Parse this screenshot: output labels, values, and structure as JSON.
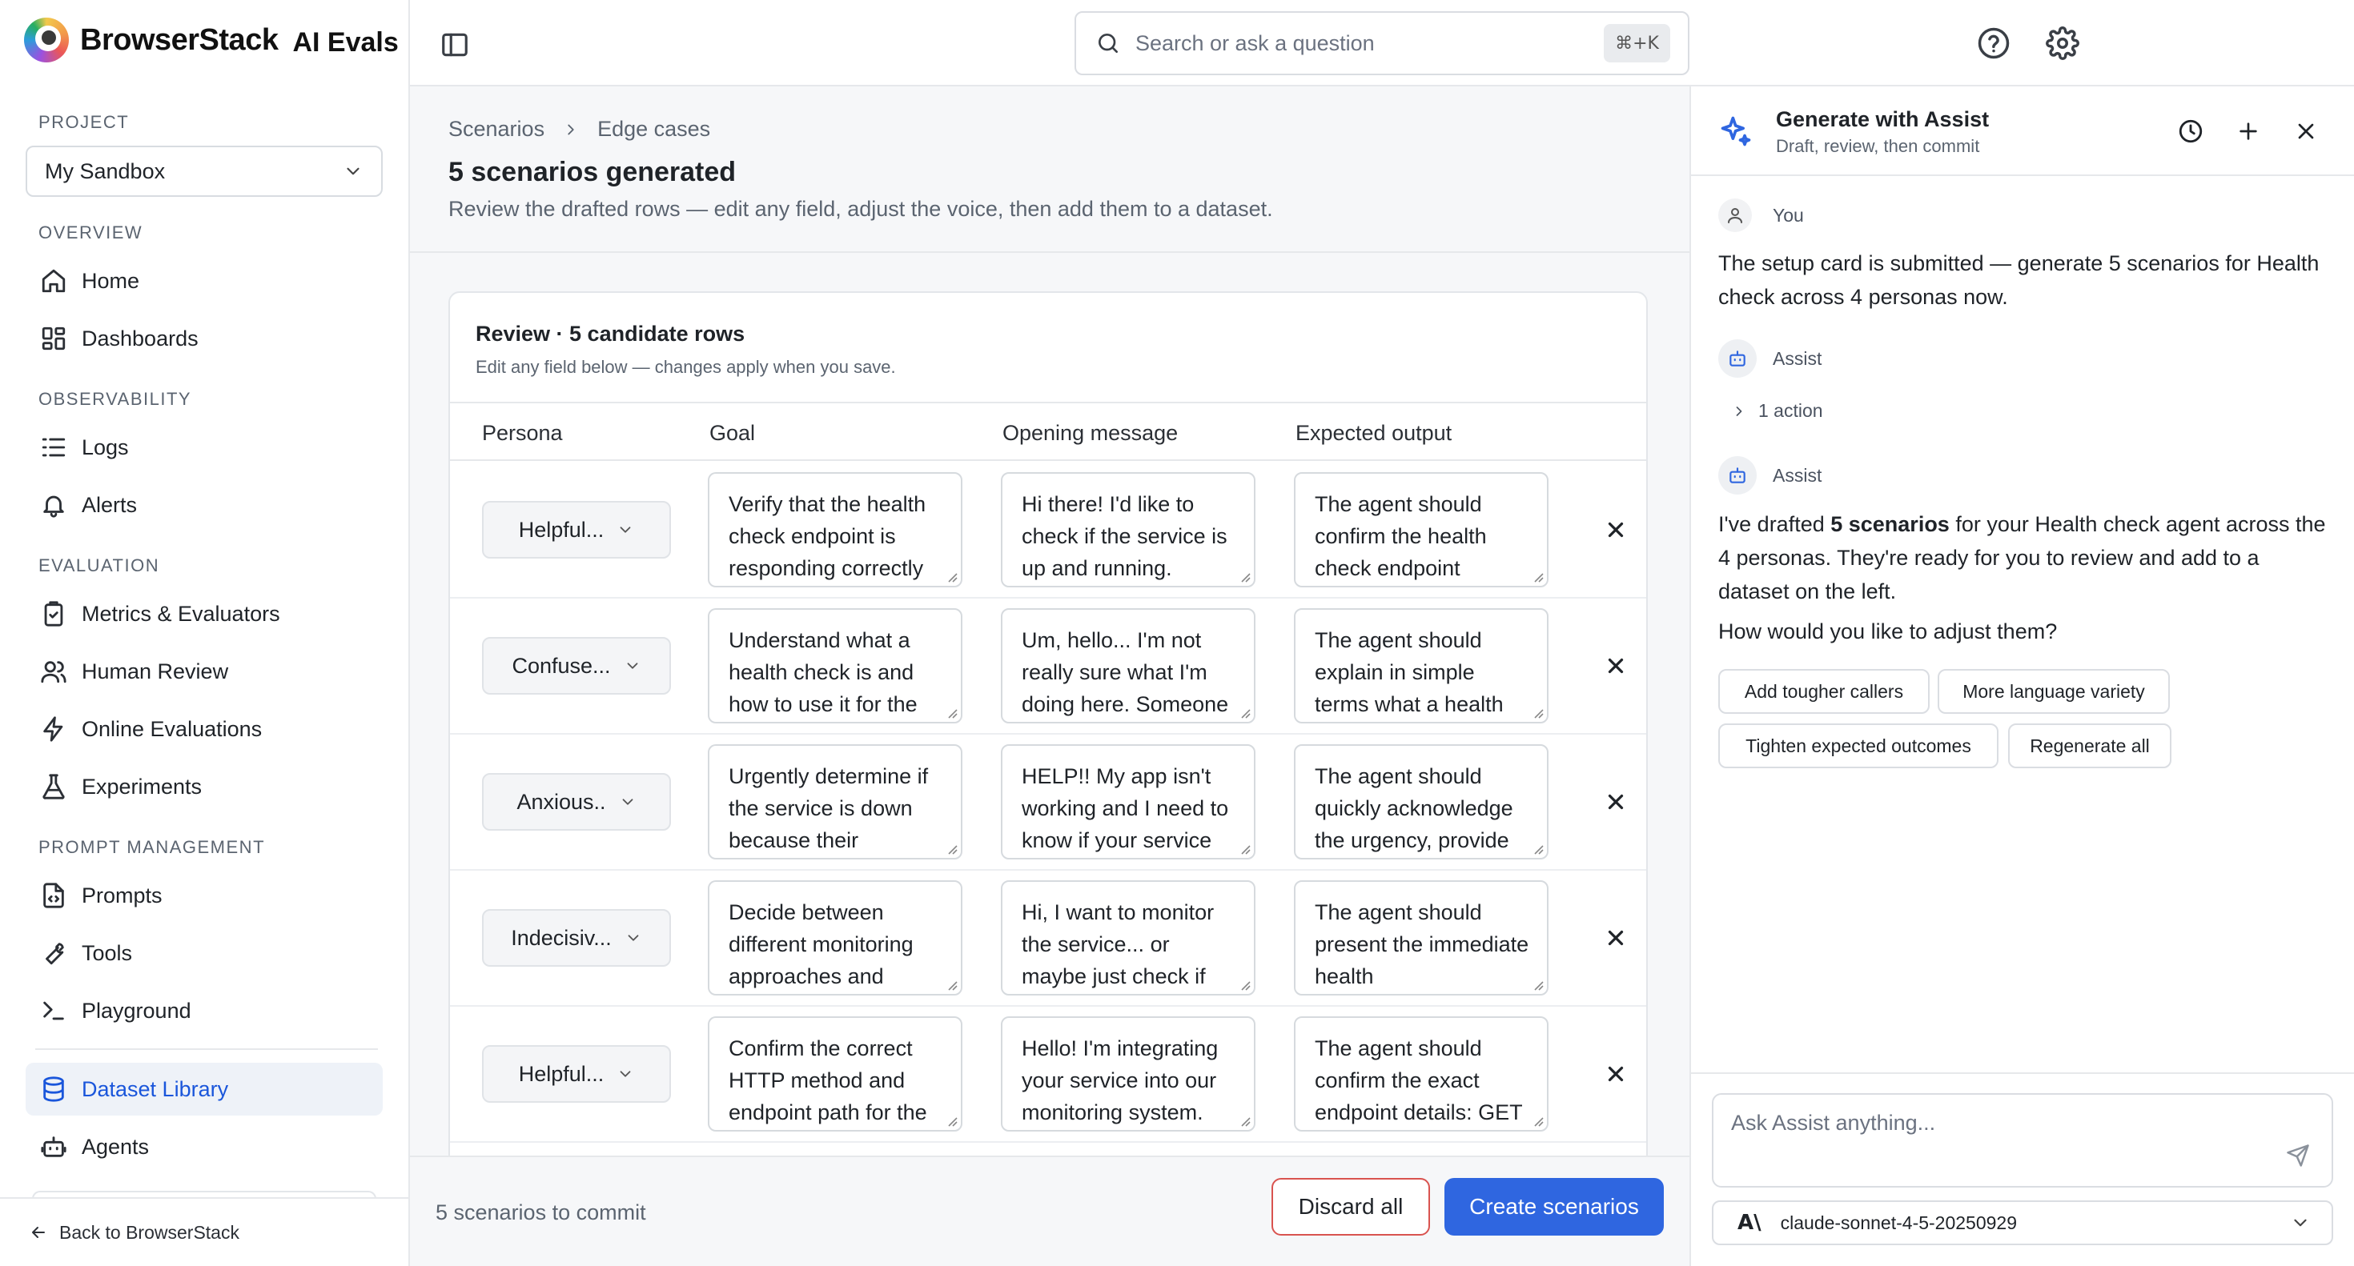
{
  "brand": {
    "name": "BrowserStack",
    "product": "AI Evals"
  },
  "sidebar": {
    "project_label": "PROJECT",
    "project_value": "My Sandbox",
    "sections": {
      "overview": "OVERVIEW",
      "observability": "OBSERVABILITY",
      "evaluation": "EVALUATION",
      "prompt_management": "PROMPT MANAGEMENT"
    },
    "items": {
      "home": "Home",
      "dashboards": "Dashboards",
      "logs": "Logs",
      "alerts": "Alerts",
      "metrics": "Metrics & Evaluators",
      "human_review": "Human Review",
      "online_evaluations": "Online Evaluations",
      "experiments": "Experiments",
      "prompts": "Prompts",
      "tools": "Tools",
      "playground": "Playground",
      "dataset_library": "Dataset Library",
      "agents": "Agents"
    },
    "active_item": "Dataset Library",
    "back_link": "Back to BrowserStack"
  },
  "topbar": {
    "search_placeholder": "Search or ask a question",
    "search_shortcut": "⌘+K",
    "icons": [
      "sidebar-toggle-icon",
      "help-icon",
      "settings-icon"
    ]
  },
  "main": {
    "breadcrumb": [
      "Scenarios",
      "Edge cases"
    ],
    "title": "5 scenarios generated",
    "subtitle": "Review the drafted rows — edit any field, adjust the voice, then add them to a dataset.",
    "review_title": "Review · 5 candidate rows",
    "review_subtitle": "Edit any field below — changes apply when you save.",
    "columns": [
      "Persona",
      "Goal",
      "Opening message",
      "Expected output"
    ],
    "rows": [
      {
        "persona": "Helpful...",
        "goal": "Verify that the health check endpoint is responding correctly",
        "opening": "Hi there! I'd like to check if the service is up and running.",
        "expected": "The agent should confirm the health check endpoint"
      },
      {
        "persona": "Confuse...",
        "goal": "Understand what a health check is and how to use it for the",
        "opening": "Um, hello... I'm not really sure what I'm doing here. Someone",
        "expected": "The agent should explain in simple terms what a health"
      },
      {
        "persona": "Anxious..",
        "goal": "Urgently determine if the service is down because their",
        "opening": "HELP!! My app isn't working and I need to know if your service",
        "expected": "The agent should quickly acknowledge the urgency, provide"
      },
      {
        "persona": "Indecisiv...",
        "goal": "Decide between different monitoring approaches and",
        "opening": "Hi, I want to monitor the service... or maybe just check if",
        "expected": "The agent should present the immediate health"
      },
      {
        "persona": "Helpful...",
        "goal": "Confirm the correct HTTP method and endpoint path for the",
        "opening": "Hello! I'm integrating your service into our monitoring system.",
        "expected": "The agent should confirm the exact endpoint details: GET"
      }
    ],
    "footer": {
      "commit_text": "5 scenarios to commit",
      "discard_label": "Discard all",
      "create_label": "Create scenarios"
    }
  },
  "assist": {
    "title": "Generate with Assist",
    "subtitle": "Draft, review, then commit",
    "messages": {
      "user_author": "You",
      "user_text": "The setup card is submitted — generate 5 scenarios for Health check across 4 personas now.",
      "bot_author_1": "Assist",
      "action_text": "1 action",
      "bot_author_2": "Assist",
      "bot_text_pre": "I've drafted ",
      "bot_text_bold": "5 scenarios",
      "bot_text_post": " for your Health check agent across the 4 personas. They're ready for you to review and add to a dataset on the left.",
      "bot_question": "How would you like to adjust them?"
    },
    "chips": [
      "Add tougher callers",
      "More language variety",
      "Tighten expected outcomes",
      "Regenerate all"
    ],
    "input_placeholder": "Ask Assist anything...",
    "model": "claude-sonnet-4-5-20250929"
  }
}
